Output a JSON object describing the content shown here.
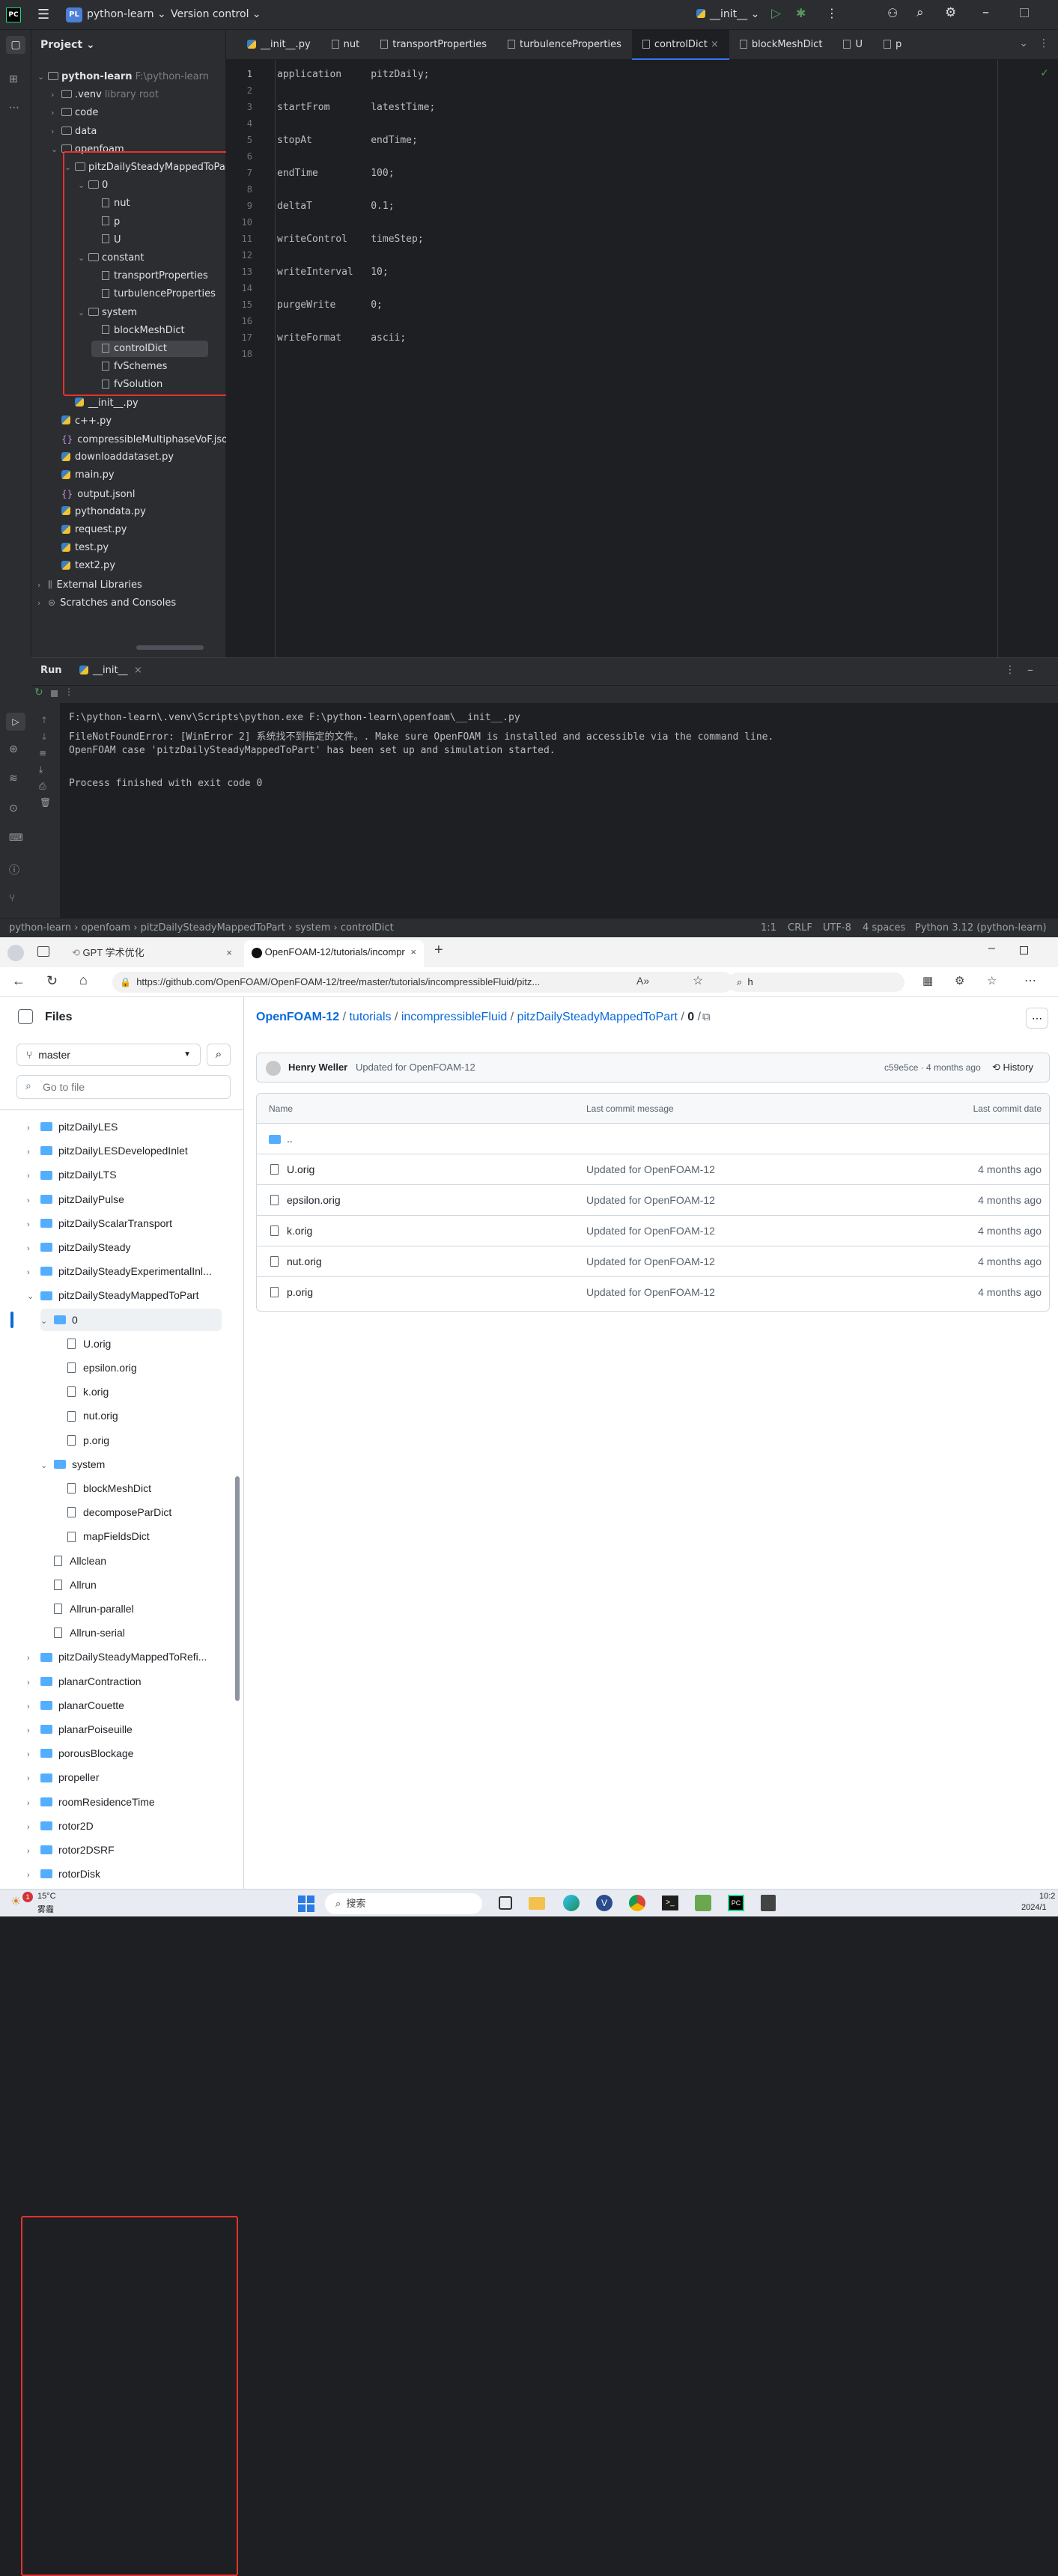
{
  "ide": {
    "logo": "PC",
    "project_badge": "PL",
    "project_name": "python-learn",
    "vcs": "Version control",
    "run_config": "__init__",
    "project_panel_title": "Project",
    "tree": [
      {
        "label": "python-learn",
        "extra": "F:\\python-learn",
        "level": 0,
        "kind": "folder",
        "open": true
      },
      {
        "label": ".venv",
        "extra": "library root",
        "level": 1,
        "kind": "folder",
        "open": false
      },
      {
        "label": "code",
        "level": 1,
        "kind": "folder",
        "open": false
      },
      {
        "label": "data",
        "level": 1,
        "kind": "folder",
        "open": false
      },
      {
        "label": "openfoam",
        "level": 1,
        "kind": "folder",
        "open": true
      },
      {
        "label": "pitzDailySteadyMappedToPart",
        "level": 2,
        "kind": "folder",
        "open": true
      },
      {
        "label": "0",
        "level": 3,
        "kind": "folder",
        "open": true
      },
      {
        "label": "nut",
        "level": 4,
        "kind": "file"
      },
      {
        "label": "p",
        "level": 4,
        "kind": "file"
      },
      {
        "label": "U",
        "level": 4,
        "kind": "file"
      },
      {
        "label": "constant",
        "level": 3,
        "kind": "folder",
        "open": true
      },
      {
        "label": "transportProperties",
        "level": 4,
        "kind": "file"
      },
      {
        "label": "turbulenceProperties",
        "level": 4,
        "kind": "file"
      },
      {
        "label": "system",
        "level": 3,
        "kind": "folder",
        "open": true
      },
      {
        "label": "blockMeshDict",
        "level": 4,
        "kind": "file"
      },
      {
        "label": "controlDict",
        "level": 4,
        "kind": "file",
        "selected": true
      },
      {
        "label": "fvSchemes",
        "level": 4,
        "kind": "file"
      },
      {
        "label": "fvSolution",
        "level": 4,
        "kind": "file"
      },
      {
        "label": "__init__.py",
        "level": 2,
        "kind": "py"
      },
      {
        "label": "c++.py",
        "level": 1,
        "kind": "py"
      },
      {
        "label": "compressibleMultiphaseVoF.json",
        "level": 1,
        "kind": "json"
      },
      {
        "label": "downloaddataset.py",
        "level": 1,
        "kind": "py"
      },
      {
        "label": "main.py",
        "level": 1,
        "kind": "py"
      },
      {
        "label": "output.jsonl",
        "level": 1,
        "kind": "json"
      },
      {
        "label": "pythondata.py",
        "level": 1,
        "kind": "py"
      },
      {
        "label": "request.py",
        "level": 1,
        "kind": "py"
      },
      {
        "label": "test.py",
        "level": 1,
        "kind": "py"
      },
      {
        "label": "text2.py",
        "level": 1,
        "kind": "py"
      },
      {
        "label": "External Libraries",
        "level": 0,
        "kind": "lib",
        "open": false
      },
      {
        "label": "Scratches and Consoles",
        "level": 0,
        "kind": "scratch",
        "open": false
      }
    ],
    "tabs": [
      "__init__.py",
      "nut",
      "transportProperties",
      "turbulenceProperties",
      "controlDict",
      "blockMeshDict",
      "U",
      "p"
    ],
    "active_tab": "controlDict",
    "code_lines": [
      "application     pitzDaily;",
      "",
      "startFrom       latestTime;",
      "",
      "stopAt          endTime;",
      "",
      "endTime         100;",
      "",
      "deltaT          0.1;",
      "",
      "writeControl    timeStep;",
      "",
      "writeInterval   10;",
      "",
      "purgeWrite      0;",
      "",
      "writeFormat     ascii;",
      ""
    ],
    "run_title": "Run",
    "run_tab": "__init__",
    "console_lines": [
      "F:\\python-learn\\.venv\\Scripts\\python.exe F:\\python-learn\\openfoam\\__init__.py",
      "FileNotFoundError: [WinError 2] 系统找不到指定的文件。. Make sure OpenFOAM is installed and accessible via the command line.",
      "OpenFOAM case 'pitzDailySteadyMappedToPart' has been set up and simulation started.",
      "",
      "Process finished with exit code 0"
    ],
    "breadcrumb": [
      "python-learn",
      "openfoam",
      "pitzDailySteadyMappedToPart",
      "system",
      "controlDict"
    ],
    "status": {
      "pos": "1:1",
      "eol": "CRLF",
      "enc": "UTF-8",
      "indent": "4 spaces",
      "interpreter": "Python 3.12 (python-learn)"
    }
  },
  "browser": {
    "tab1": "GPT 学术优化",
    "tab2": "OpenFOAM-12/tutorials/incompr",
    "url": "https://github.com/OpenFOAM/OpenFOAM-12/tree/master/tutorials/incompressibleFluid/pitz...",
    "search_value": "h",
    "files_title": "Files",
    "branch": "master",
    "goto_placeholder": "Go to file",
    "side_tree": [
      {
        "label": "pitzDailyLES",
        "level": 0,
        "kind": "folder"
      },
      {
        "label": "pitzDailyLESDevelopedInlet",
        "level": 0,
        "kind": "folder"
      },
      {
        "label": "pitzDailyLTS",
        "level": 0,
        "kind": "folder"
      },
      {
        "label": "pitzDailyPulse",
        "level": 0,
        "kind": "folder"
      },
      {
        "label": "pitzDailyScalarTransport",
        "level": 0,
        "kind": "folder"
      },
      {
        "label": "pitzDailySteady",
        "level": 0,
        "kind": "folder"
      },
      {
        "label": "pitzDailySteadyExperimentalInl...",
        "level": 0,
        "kind": "folder"
      },
      {
        "label": "pitzDailySteadyMappedToPart",
        "level": 0,
        "kind": "folder",
        "open": true
      },
      {
        "label": "0",
        "level": 1,
        "kind": "folder",
        "open": true,
        "selected": true
      },
      {
        "label": "U.orig",
        "level": 2,
        "kind": "file"
      },
      {
        "label": "epsilon.orig",
        "level": 2,
        "kind": "file"
      },
      {
        "label": "k.orig",
        "level": 2,
        "kind": "file"
      },
      {
        "label": "nut.orig",
        "level": 2,
        "kind": "file"
      },
      {
        "label": "p.orig",
        "level": 2,
        "kind": "file"
      },
      {
        "label": "system",
        "level": 1,
        "kind": "folder",
        "open": true
      },
      {
        "label": "blockMeshDict",
        "level": 2,
        "kind": "file"
      },
      {
        "label": "decomposeParDict",
        "level": 2,
        "kind": "file"
      },
      {
        "label": "mapFieldsDict",
        "level": 2,
        "kind": "file"
      },
      {
        "label": "Allclean",
        "level": 1,
        "kind": "file"
      },
      {
        "label": "Allrun",
        "level": 1,
        "kind": "file"
      },
      {
        "label": "Allrun-parallel",
        "level": 1,
        "kind": "file"
      },
      {
        "label": "Allrun-serial",
        "level": 1,
        "kind": "file"
      },
      {
        "label": "pitzDailySteadyMappedToRefi...",
        "level": 0,
        "kind": "folder"
      },
      {
        "label": "planarContraction",
        "level": 0,
        "kind": "folder"
      },
      {
        "label": "planarCouette",
        "level": 0,
        "kind": "folder"
      },
      {
        "label": "planarPoiseuille",
        "level": 0,
        "kind": "folder"
      },
      {
        "label": "porousBlockage",
        "level": 0,
        "kind": "folder"
      },
      {
        "label": "propeller",
        "level": 0,
        "kind": "folder"
      },
      {
        "label": "roomResidenceTime",
        "level": 0,
        "kind": "folder"
      },
      {
        "label": "rotor2D",
        "level": 0,
        "kind": "folder"
      },
      {
        "label": "rotor2DSRF",
        "level": 0,
        "kind": "folder"
      },
      {
        "label": "rotorDisk",
        "level": 0,
        "kind": "folder"
      }
    ],
    "crumbs": [
      "OpenFOAM-12",
      "tutorials",
      "incompressibleFluid",
      "pitzDailySteadyMappedToPart",
      "0"
    ],
    "commit_author": "Henry Weller",
    "commit_msg": "Updated for OpenFOAM-12",
    "commit_meta": "c59e5ce · 4 months ago",
    "history": "History",
    "table_headers": [
      "Name",
      "Last commit message",
      "Last commit date"
    ],
    "parent_dir": "..",
    "rows": [
      {
        "name": "U.orig",
        "msg": "Updated for OpenFOAM-12",
        "date": "4 months ago"
      },
      {
        "name": "epsilon.orig",
        "msg": "Updated for OpenFOAM-12",
        "date": "4 months ago"
      },
      {
        "name": "k.orig",
        "msg": "Updated for OpenFOAM-12",
        "date": "4 months ago"
      },
      {
        "name": "nut.orig",
        "msg": "Updated for OpenFOAM-12",
        "date": "4 months ago"
      },
      {
        "name": "p.orig",
        "msg": "Updated for OpenFOAM-12",
        "date": "4 months ago"
      }
    ]
  },
  "taskbar": {
    "weather_temp": "15°C",
    "weather_desc": "雾霾",
    "search": "搜索",
    "time": "10:2",
    "date": "2024/1"
  },
  "colors": {
    "ide_bg": "#1e1f22",
    "ide_panel": "#2b2d30",
    "accent": "#3574f0",
    "gh_link": "#0969da",
    "highlight_red": "#e5312d"
  }
}
